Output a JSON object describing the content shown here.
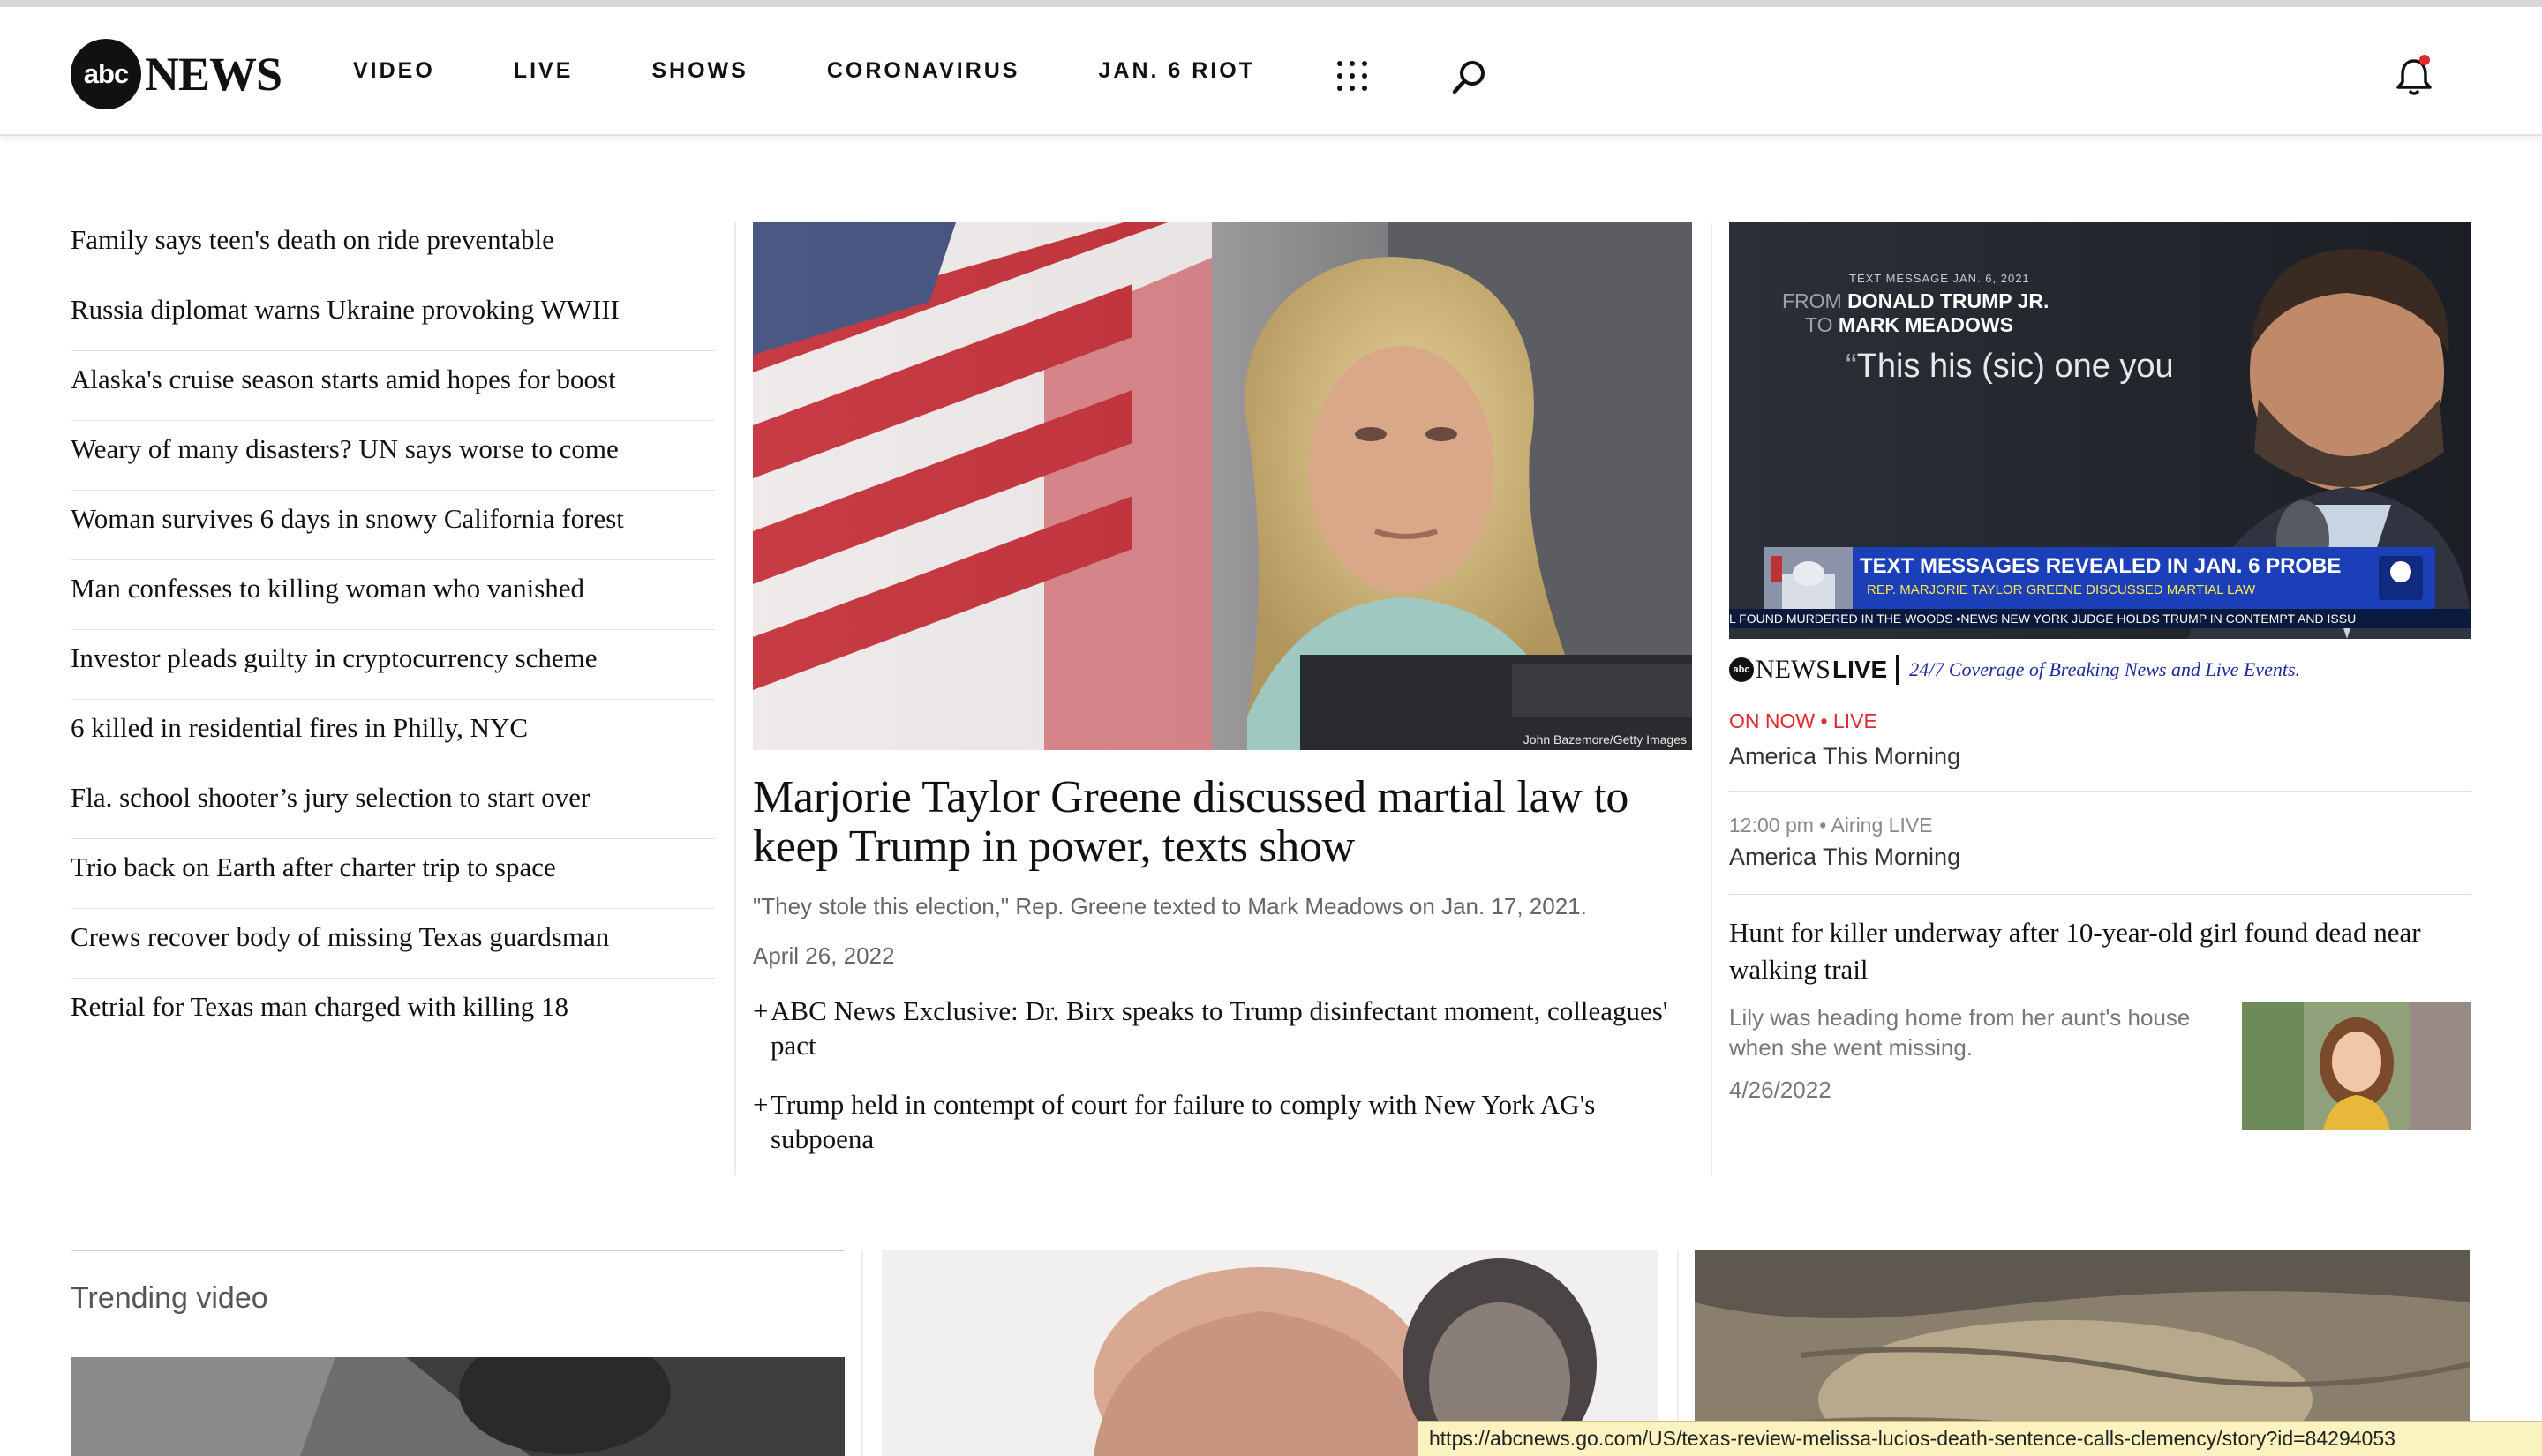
{
  "header": {
    "logo_badge": "abc",
    "logo_word": "NEWS",
    "nav": [
      "VIDEO",
      "LIVE",
      "SHOWS",
      "CORONAVIRUS",
      "JAN. 6 RIOT"
    ]
  },
  "headlines": [
    "Family says teen's death on ride preventable",
    "Russia diplomat warns Ukraine provoking WWIII",
    "Alaska's cruise season starts amid hopes for boost",
    "Weary of many disasters? UN says worse to come",
    "Woman survives 6 days in snowy California forest",
    "Man confesses to killing woman who vanished",
    "Investor pleads guilty in cryptocurrency scheme",
    "6 killed in residential fires in Philly, NYC",
    "Fla. school shooter’s jury selection to start over",
    "Trio back on Earth after charter trip to space",
    "Crews recover body of missing Texas guardsman",
    "Retrial for Texas man charged with killing 18"
  ],
  "hero": {
    "photo_credit": "John Bazemore/Getty Images",
    "title": "Marjorie Taylor Greene discussed martial law to keep Trump in power, texts show",
    "description": "\"They stole this election,\" Rep. Greene texted to Mark Meadows on Jan. 17, 2021.",
    "date": "April 26, 2022",
    "related": [
      "ABC News Exclusive: Dr. Birx speaks to Trump disinfectant moment, colleagues' pact",
      "Trump held in contempt of court for failure to comply with New York AG's subpoena"
    ]
  },
  "live": {
    "tv_small": "TEXT MESSAGE  JAN. 6, 2021",
    "tv_from_label": "FROM",
    "tv_from": "DONALD TRUMP JR.",
    "tv_to_label": "TO",
    "tv_to": "MARK MEADOWS",
    "tv_quote": "This his (sic) one you",
    "tv_banner_title": "TEXT MESSAGES REVEALED IN JAN. 6 PROBE",
    "tv_banner_sub": "REP. MARJORIE TAYLOR GREENE DISCUSSED MARTIAL LAW",
    "tv_ticker": "L FOUND MURDERED IN THE WOODS     ▪NEWS     NEW YORK JUDGE HOLDS TRUMP IN CONTEMPT AND ISSU",
    "brand_dot": "abc",
    "brand_word": "NEWS",
    "brand_live": "LIVE",
    "brand_tagline": "24/7 Coverage of Breaking News and Live Events.",
    "on_now": "ON NOW • LIVE",
    "show_now": "America This Morning",
    "schedule": "12:00 pm  •  Airing LIVE",
    "show_next": "America This Morning"
  },
  "story2": {
    "title": "Hunt for killer underway after 10-year-old girl found dead near walking trail",
    "description": "Lily was heading home from her aunt's house when she went missing.",
    "date": "4/26/2022"
  },
  "trending": {
    "title": "Trending video"
  },
  "statusbar": {
    "url": "https://abcnews.go.com/US/texas-review-melissa-lucios-death-sentence-calls-clemency/story?id=84294053"
  },
  "colors": {
    "live_red": "#e0282e",
    "tagline_blue": "#1a2aa0",
    "banner_blue": "#1a3fb8",
    "status_yellow": "#fbf3bf"
  }
}
